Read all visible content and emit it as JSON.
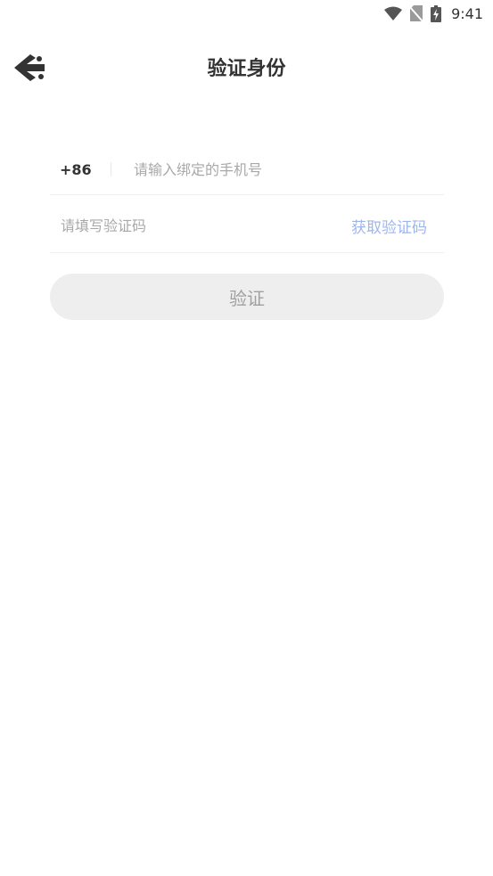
{
  "status_bar": {
    "time": "9:41",
    "icons": [
      "wifi-icon",
      "no-sim-icon",
      "battery-charging-icon"
    ]
  },
  "header": {
    "back_icon": "back-arrow-icon",
    "title": "验证身份"
  },
  "form": {
    "country_code": "+86",
    "phone": {
      "value": "",
      "placeholder": "请输入绑定的手机号"
    },
    "code": {
      "value": "",
      "placeholder": "请填写验证码"
    },
    "get_code_label": "获取验证码"
  },
  "verify_button": {
    "label": "验证"
  },
  "colors": {
    "title": "#333333",
    "placeholder": "#a8a8a8",
    "link_disabled": "#9db6f0",
    "button_bg_disabled": "#eeeeee",
    "button_text_disabled": "#a0a0a0"
  }
}
